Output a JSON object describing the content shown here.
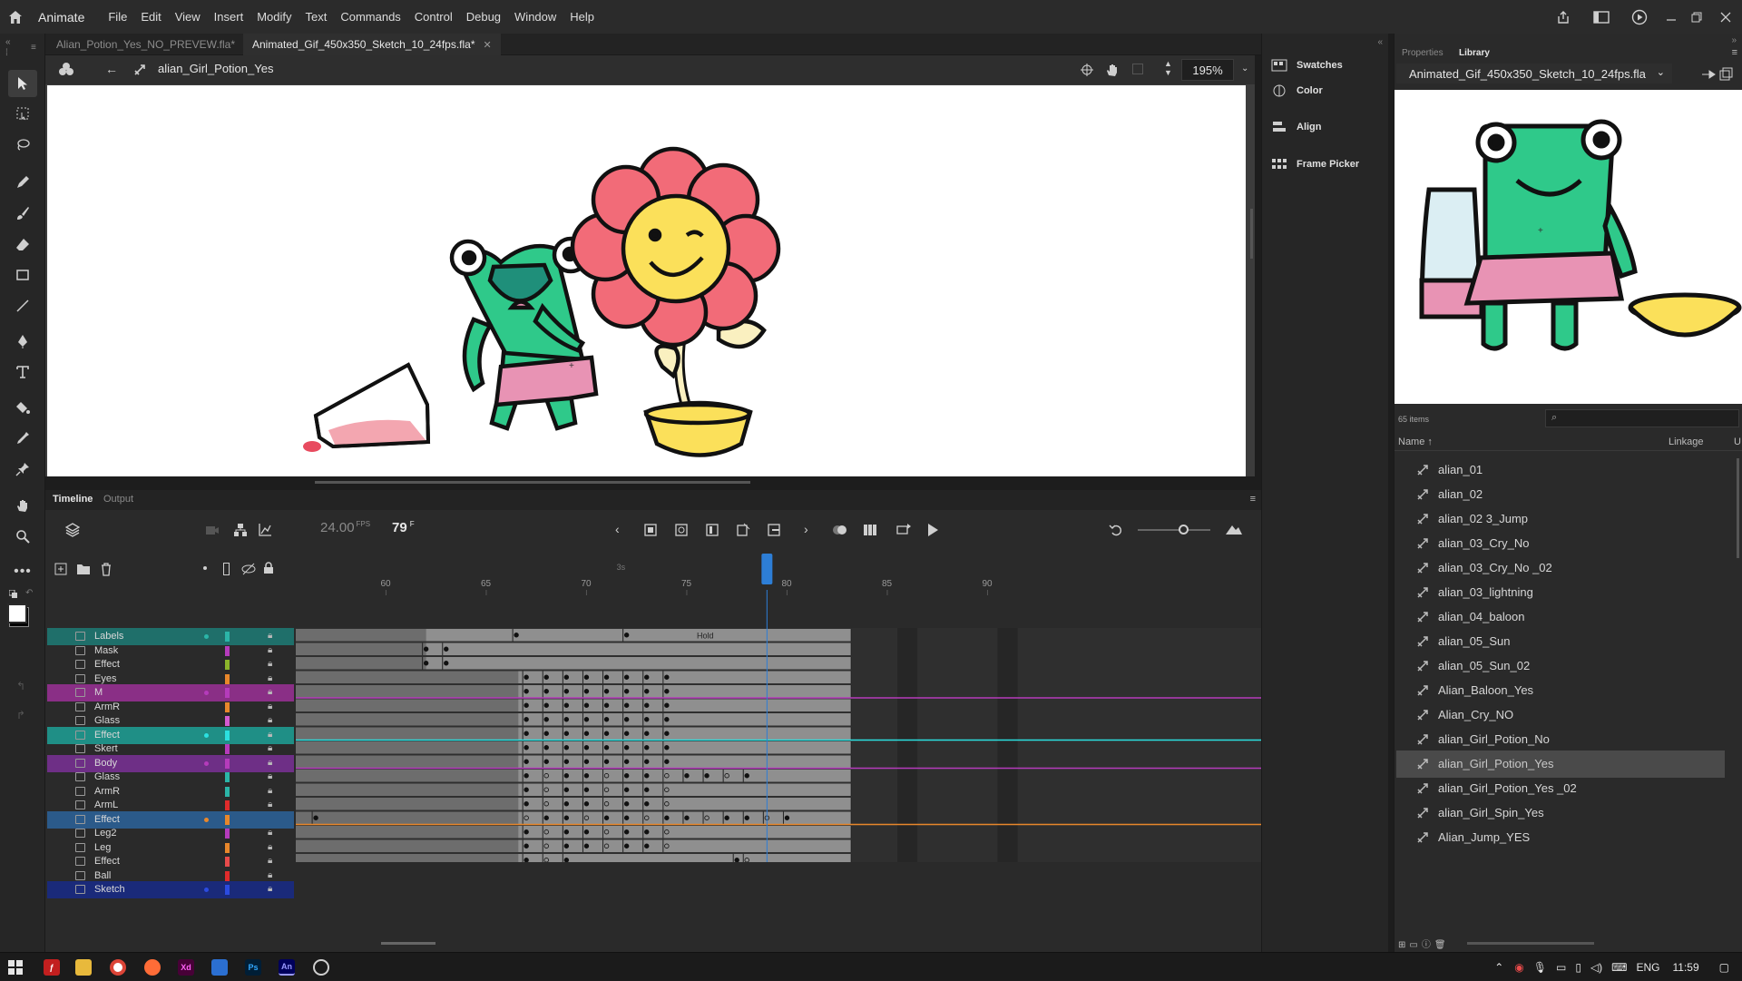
{
  "app": {
    "name": "Animate",
    "menu": [
      "File",
      "Edit",
      "View",
      "Insert",
      "Modify",
      "Text",
      "Commands",
      "Control",
      "Debug",
      "Window",
      "Help"
    ]
  },
  "tabs": [
    {
      "label": "Alian_Potion_Yes_NO_PREVEW.fla*",
      "active": false
    },
    {
      "label": "Animated_Gif_450x350_Sketch_10_24fps.fla*",
      "active": true
    }
  ],
  "editbar": {
    "scene_name": "alian_Girl_Potion_Yes",
    "zoom": "195%"
  },
  "timeline": {
    "tabs": [
      "Timeline",
      "Output"
    ],
    "fps": "24.00",
    "fps_unit": "FPS",
    "current_frame": "79",
    "frame_unit": "F",
    "ruler_marks": [
      "60",
      "65",
      "70",
      "75",
      "80",
      "85",
      "90"
    ],
    "ruler_seconds_label": "3s",
    "frame_label": "Hold",
    "layers": [
      {
        "name": "Labels",
        "color": "#2bb5a8"
      },
      {
        "name": "Mask",
        "color": "#b53bbb"
      },
      {
        "name": "Effect",
        "color": "#8bb52b"
      },
      {
        "name": "Eyes",
        "color": "#e8872b"
      },
      {
        "name": "M",
        "color": "#b53bbb"
      },
      {
        "name": "ArmR",
        "color": "#e8872b"
      },
      {
        "name": "Glass",
        "color": "#d45ad0"
      },
      {
        "name": "Effect",
        "color": "#2be0e0"
      },
      {
        "name": "Skert",
        "color": "#b53bbb"
      },
      {
        "name": "Body",
        "color": "#b53bbb"
      },
      {
        "name": "Glass",
        "color": "#2bb5a8"
      },
      {
        "name": "ArmR",
        "color": "#2bb5a8"
      },
      {
        "name": "ArmL",
        "color": "#e02b2b"
      },
      {
        "name": "Effect",
        "color": "#e8872b"
      },
      {
        "name": "Leg2",
        "color": "#b53bbb"
      },
      {
        "name": "Leg",
        "color": "#e8872b"
      },
      {
        "name": "Effect",
        "color": "#e84b4b"
      },
      {
        "name": "Ball",
        "color": "#e02b2b"
      },
      {
        "name": "Sketch",
        "color": "#2b4be0"
      }
    ]
  },
  "panels": {
    "collapsed": [
      "Swatches",
      "Color",
      "Align",
      "Frame Picker"
    ]
  },
  "library": {
    "tabs": [
      "Properties",
      "Library"
    ],
    "document": "Animated_Gif_450x350_Sketch_10_24fps.fla",
    "count": "65 items",
    "columns": [
      "Name ↑",
      "Linkage",
      "U"
    ],
    "items": [
      "alian_01",
      "alian_02",
      "alian_02 3_Jump",
      "alian_03_Cry_No",
      "alian_03_Cry_No _02",
      "alian_03_lightning",
      "alian_04_baloon",
      "alian_05_Sun",
      "alian_05_Sun_02",
      "Alian_Baloon_Yes",
      "Alian_Cry_NO",
      "alian_Girl_Potion_No",
      "alian_Girl_Potion_Yes",
      "alian_Girl_Potion_Yes _02",
      "alian_Girl_Spin_Yes",
      "Alian_Jump_YES"
    ],
    "selected": "alian_Girl_Potion_Yes"
  },
  "taskbar": {
    "lang": "ENG",
    "time": "11:59"
  }
}
